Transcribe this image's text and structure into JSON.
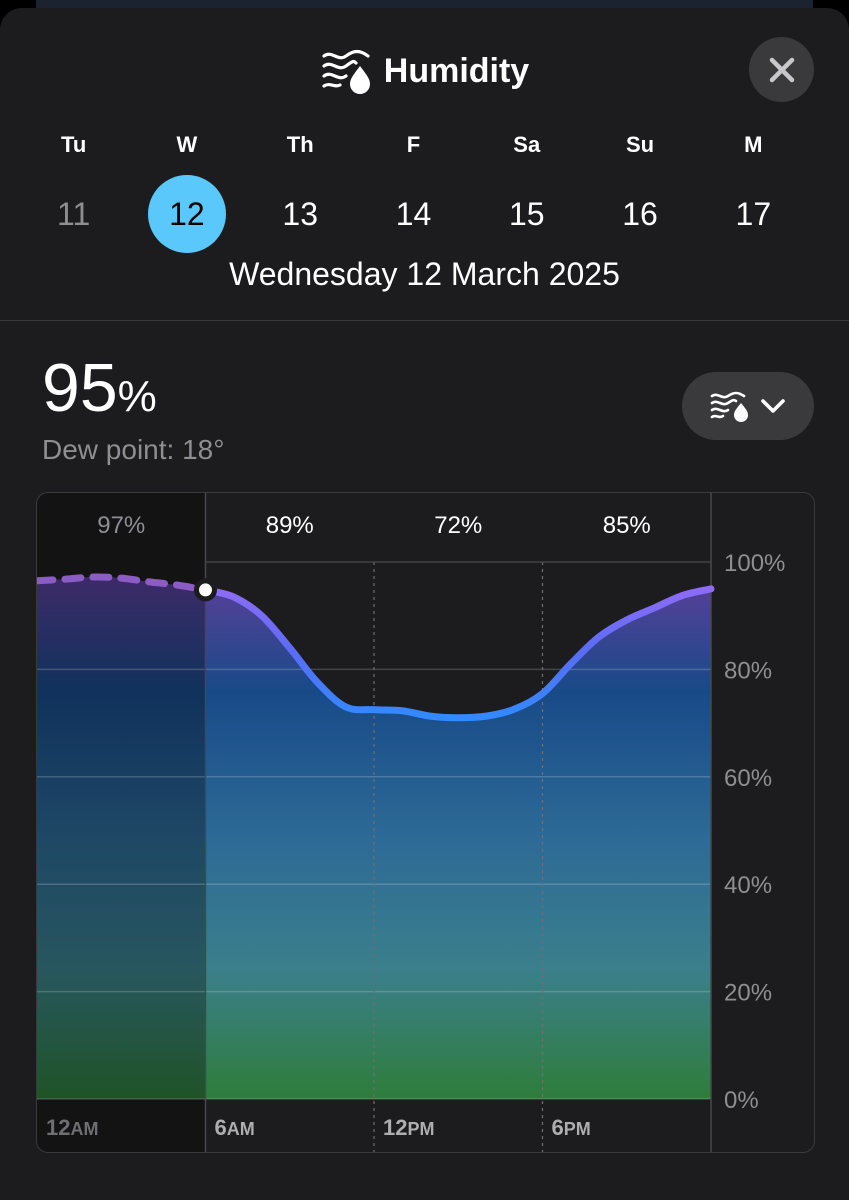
{
  "header": {
    "title": "Humidity",
    "close_label": "Close"
  },
  "days": [
    {
      "dow": "Tu",
      "num": "11",
      "state": "past"
    },
    {
      "dow": "W",
      "num": "12",
      "state": "selected"
    },
    {
      "dow": "Th",
      "num": "13",
      "state": "future"
    },
    {
      "dow": "F",
      "num": "14",
      "state": "future"
    },
    {
      "dow": "Sa",
      "num": "15",
      "state": "future"
    },
    {
      "dow": "Su",
      "num": "16",
      "state": "future"
    },
    {
      "dow": "M",
      "num": "17",
      "state": "future"
    }
  ],
  "selected_date": "Wednesday 12 March 2025",
  "current": {
    "value": "95",
    "unit": "%",
    "dew_point": "Dew point: 18°"
  },
  "picker": {
    "icon": "humidity-icon",
    "chevron": "chevron-down-icon"
  },
  "colors": {
    "accent": "#5ac8fa",
    "line_top": "#a46bf5",
    "line_low": "#2f8cff",
    "fill_bottom": "#2e7d3a"
  },
  "chart_data": {
    "type": "area",
    "x_ticks": [
      "12AM",
      "6AM",
      "12PM",
      "6PM"
    ],
    "y_ticks": [
      "100%",
      "80%",
      "60%",
      "40%",
      "20%",
      "0%"
    ],
    "ylim": [
      0,
      100
    ],
    "xlim": [
      0,
      24
    ],
    "period_labels": [
      "97%",
      "89%",
      "72%",
      "85%"
    ],
    "current_hour": 6,
    "points": [
      {
        "x": 0,
        "y": 96.5
      },
      {
        "x": 1,
        "y": 96.8
      },
      {
        "x": 2,
        "y": 97.2
      },
      {
        "x": 3,
        "y": 97
      },
      {
        "x": 4,
        "y": 96.3
      },
      {
        "x": 5,
        "y": 95.7
      },
      {
        "x": 6,
        "y": 94.8
      },
      {
        "x": 7,
        "y": 93.5
      },
      {
        "x": 8,
        "y": 90
      },
      {
        "x": 9,
        "y": 84
      },
      {
        "x": 10,
        "y": 77.5
      },
      {
        "x": 11,
        "y": 73
      },
      {
        "x": 12,
        "y": 72.5
      },
      {
        "x": 13,
        "y": 72.3
      },
      {
        "x": 14,
        "y": 71.3
      },
      {
        "x": 15,
        "y": 71
      },
      {
        "x": 16,
        "y": 71.3
      },
      {
        "x": 17,
        "y": 72.6
      },
      {
        "x": 18,
        "y": 75.5
      },
      {
        "x": 19,
        "y": 81
      },
      {
        "x": 20,
        "y": 86
      },
      {
        "x": 21,
        "y": 89.2
      },
      {
        "x": 22,
        "y": 91.5
      },
      {
        "x": 23,
        "y": 93.8
      },
      {
        "x": 24,
        "y": 95
      }
    ],
    "grid": true
  }
}
